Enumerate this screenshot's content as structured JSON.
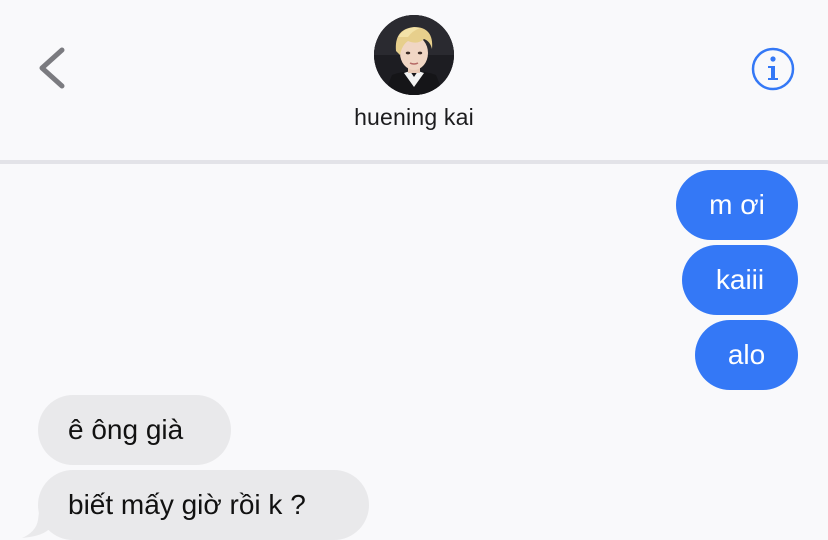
{
  "header": {
    "contact_name": "huening kai",
    "back_icon": "chevron-left-icon",
    "info_icon": "info-circle-icon",
    "avatar_icon": "contact-avatar"
  },
  "messages": [
    {
      "direction": "sent",
      "text": "m ơi"
    },
    {
      "direction": "sent",
      "text": "kaiii"
    },
    {
      "direction": "sent",
      "text": "alo"
    },
    {
      "direction": "received",
      "text": "ê ông già"
    },
    {
      "direction": "received",
      "text": "biết mấy giờ rồi k ?"
    }
  ],
  "colors": {
    "sent_bubble": "#3478f6",
    "received_bubble": "#e9e9eb",
    "accent": "#3478f6",
    "background": "#f9f9fb"
  }
}
